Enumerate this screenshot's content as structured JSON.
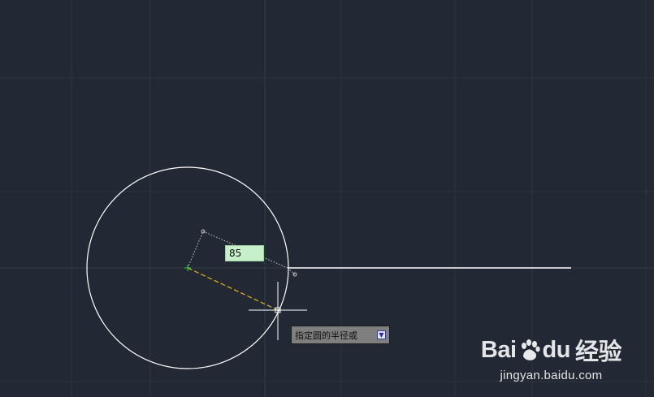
{
  "drawing": {
    "radius_input": "85"
  },
  "command": {
    "prompt": "指定圆的半径或",
    "options_icon": "down-arrow-icon"
  },
  "watermark": {
    "logo_part1": "Bai",
    "logo_part2": "du",
    "logo_suffix": "经验",
    "url": "jingyan.baidu.com"
  },
  "colors": {
    "background": "#222834",
    "grid": "#2e3542",
    "geometry": "#ffffff",
    "radius_line": "#e7b21c",
    "input_bg": "#c7efc9"
  }
}
